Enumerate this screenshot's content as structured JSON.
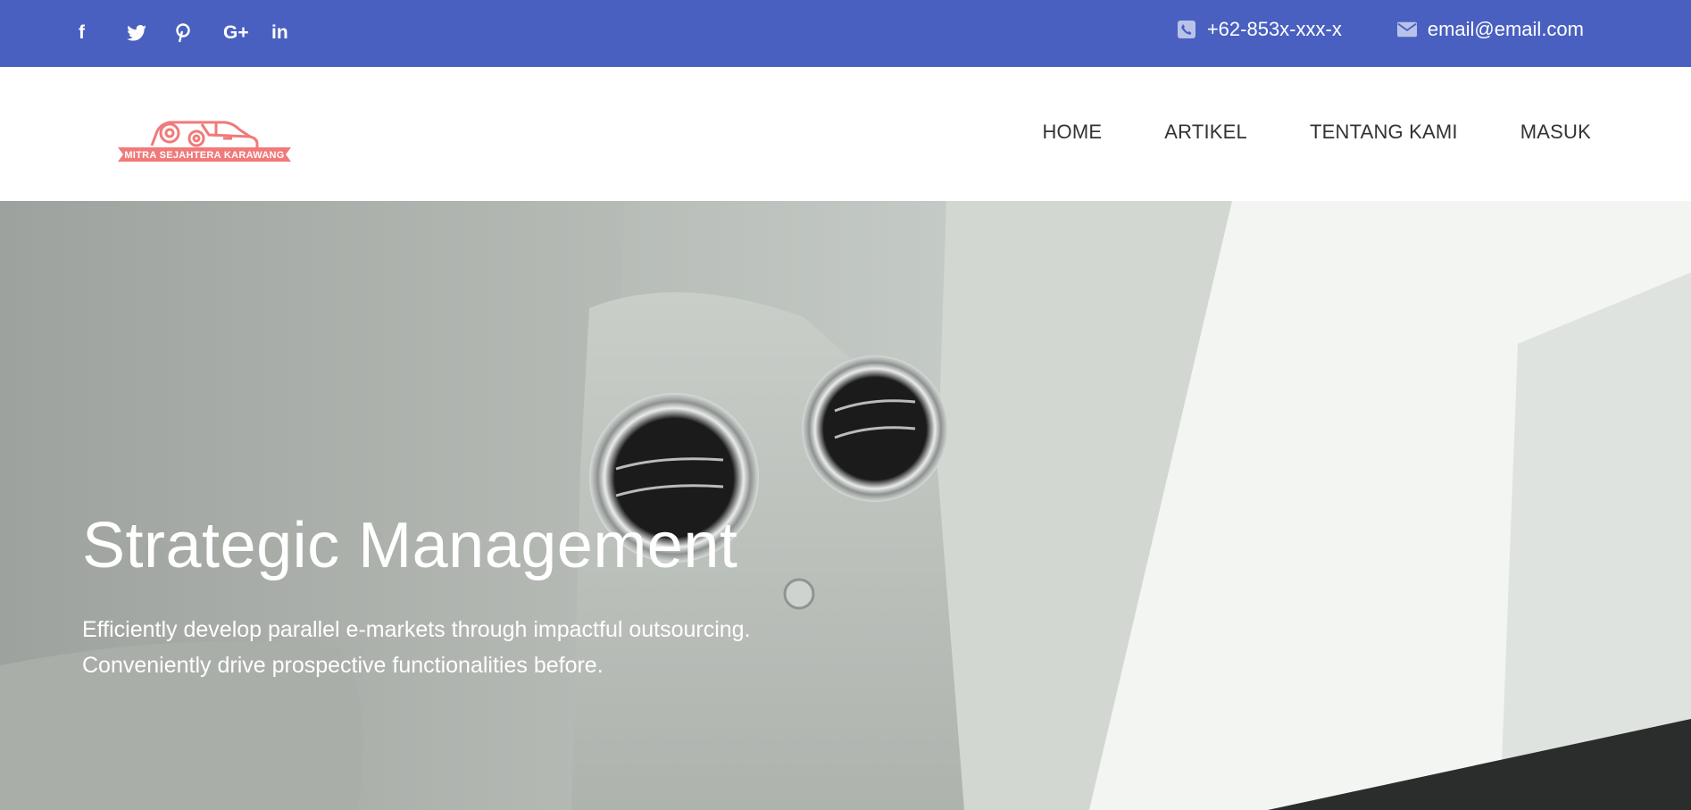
{
  "topbar": {
    "social": [
      {
        "name": "facebook",
        "glyph": "f"
      },
      {
        "name": "twitter",
        "glyph": "t"
      },
      {
        "name": "pinterest",
        "glyph": "p"
      },
      {
        "name": "google-plus",
        "glyph": "G+"
      },
      {
        "name": "linkedin",
        "glyph": "in"
      }
    ],
    "phone": "+62-853x-xxx-x",
    "email": "email@email.com",
    "background": "#4a60c0"
  },
  "header": {
    "logo_text": "MITRA SEJAHTERA KARAWANG",
    "logo_color": "#f07a7a",
    "nav": [
      "HOME",
      "ARTIKEL",
      "TENTANG KAMI",
      "MASUK"
    ]
  },
  "hero": {
    "title": "Strategic Management",
    "subtitle_line1": "Efficiently develop parallel e-markets through impactful outsourcing.",
    "subtitle_line2": "Conveniently drive prospective functionalities before."
  }
}
